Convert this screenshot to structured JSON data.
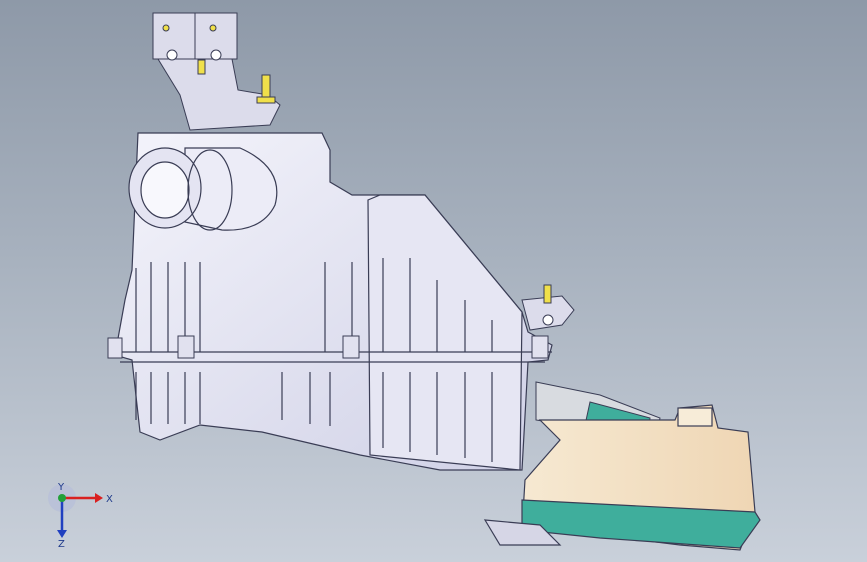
{
  "viewport": {
    "background_top": "#8e99a8",
    "background_bottom": "#c9d0da"
  },
  "model": {
    "housing_color": "#e9e9f5",
    "outline_color": "#3a3d55",
    "bracket_color": "#dcdceb",
    "duct_color": "#f5e6cf",
    "seal_color": "#3fae9c",
    "bolt_color": "#f0e04a"
  },
  "triad": {
    "x_label": "X",
    "y_label": "Y",
    "z_label": "Z",
    "x_color": "#d92020",
    "y_color": "#22a03a",
    "z_color": "#2040c0"
  }
}
